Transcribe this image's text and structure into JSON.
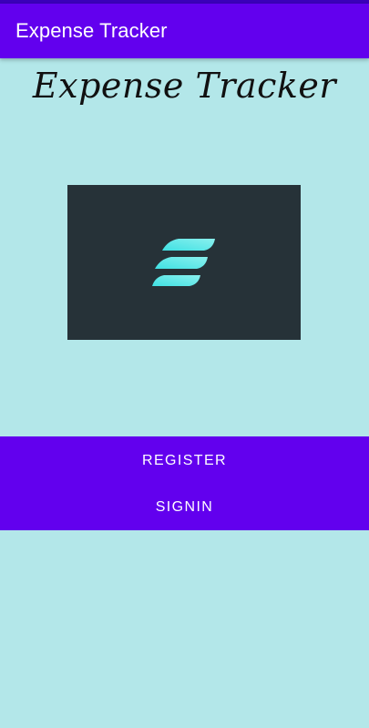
{
  "app_bar": {
    "title": "Expense Tracker"
  },
  "header": {
    "script_title": "Expense Tracker"
  },
  "logo": {
    "icon": "stacked-e-logo-icon",
    "card_color": "#263238",
    "accent_colors": [
      "#3fe1e3",
      "#8af0ee"
    ]
  },
  "actions": {
    "register_label": "REGISTER",
    "signin_label": "SIGNIN"
  },
  "colors": {
    "primary": "#6200ee",
    "background": "#b3e7e9"
  }
}
